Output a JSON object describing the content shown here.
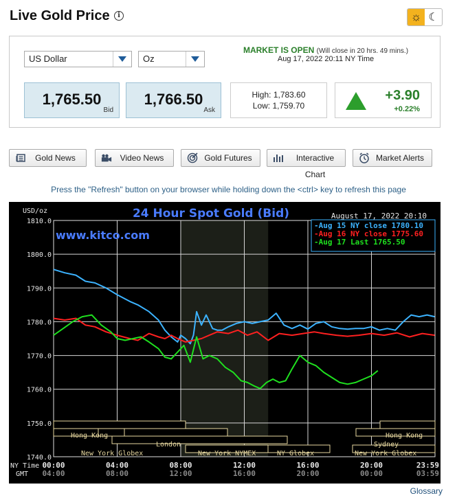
{
  "header": {
    "title": "Live Gold Price",
    "info_icon": "info-icon",
    "sun_icon": "sun-icon",
    "moon_icon": "moon-icon",
    "accent": "#f3b21e"
  },
  "selectors": {
    "currency": "US Dollar",
    "unit": "Oz"
  },
  "market": {
    "status": "MARKET IS OPEN",
    "note": "(Will close in 20 hrs. 49 mins.)",
    "time": "Aug 17, 2022 20:11 NY Time"
  },
  "quote": {
    "bid": "1,765.50",
    "bid_label": "Bid",
    "ask": "1,766.50",
    "ask_label": "Ask"
  },
  "range": {
    "high_label": "High:",
    "high": "1,783.60",
    "low_label": "Low:",
    "low": "1,759.70"
  },
  "change": {
    "amount": "+3.90",
    "percent": "+0.22%",
    "color": "#2a7f2a"
  },
  "buttons": [
    {
      "label": "Gold News",
      "icon": "newspaper-icon"
    },
    {
      "label": "Video News",
      "icon": "video-camera-icon"
    },
    {
      "label": "Gold Futures",
      "icon": "target-icon"
    },
    {
      "label": "Interactive Chart",
      "icon": "bar-chart-icon"
    },
    {
      "label": "Market Alerts",
      "icon": "alarm-clock-icon"
    }
  ],
  "refresh_note": "Press the \"Refresh\" button on your browser while holding down the <ctrl> key to refresh this page",
  "glossary": "Glossary",
  "chart_data": {
    "type": "line",
    "title": "24 Hour Spot Gold (Bid)",
    "timestamp": "August 17, 2022 20:10",
    "watermark": "www.kitco.com",
    "ylabel": "USD/oz",
    "ylim": [
      1740,
      1810
    ],
    "yticks": [
      "1810.0",
      "1800.0",
      "1790.0",
      "1780.0",
      "1770.0",
      "1760.0",
      "1750.0",
      "1740.0"
    ],
    "x_row1_label": "NY Time",
    "x_row2_label": "GMT",
    "xticks_ny": [
      "00:00",
      "04:00",
      "08:00",
      "12:00",
      "16:00",
      "20:00",
      "23:59"
    ],
    "xticks_gmt": [
      "04:00",
      "08:00",
      "12:00",
      "16:00",
      "20:00",
      "00:00",
      "03:59"
    ],
    "legend": [
      {
        "label": "Aug 15 NY close 1780.10",
        "color": "#3cb3ff"
      },
      {
        "label": "Aug 16 NY close 1775.60",
        "color": "#ff2020"
      },
      {
        "label": "Aug 17 Last 1765.50",
        "color": "#1fe01f"
      }
    ],
    "sessions": [
      "Hong Kong",
      "London",
      "New York Globex",
      "New York NYMEX",
      "NY Globex",
      "Sydney",
      "Hong Kong",
      "New York Globex"
    ],
    "series": [
      {
        "name": "Aug 15",
        "color": "#3cb3ff",
        "x": [
          0,
          0.7,
          1.4,
          2,
          2.6,
          3.3,
          4,
          4.8,
          5.3,
          6,
          6.6,
          7,
          7.4,
          7.8,
          8,
          8.3,
          8.6,
          8.8,
          9,
          9.3,
          9.6,
          10,
          10.3,
          10.6,
          11,
          11.5,
          12,
          12.5,
          13,
          13.5,
          14,
          14.5,
          15,
          15.5,
          16,
          16.5,
          17,
          17.5,
          18,
          18.5,
          19,
          19.5,
          20,
          20.5,
          21,
          21.5,
          22,
          22.5,
          23,
          23.5,
          23.98
        ],
        "values": [
          1795.5,
          1794.5,
          1793.8,
          1792,
          1791.5,
          1790,
          1788,
          1786,
          1785,
          1783,
          1780.5,
          1777.5,
          1775.5,
          1774,
          1776,
          1775,
          1773.5,
          1776,
          1783,
          1779,
          1782,
          1778,
          1777.5,
          1777.5,
          1778.5,
          1779.5,
          1780,
          1779.5,
          1780,
          1780.5,
          1782.5,
          1779,
          1778,
          1779,
          1777.8,
          1779.5,
          1780,
          1778.5,
          1778,
          1777.8,
          1778,
          1778,
          1778.5,
          1777.5,
          1778,
          1777.5,
          1780,
          1782,
          1781.5,
          1782,
          1781.5
        ]
      },
      {
        "name": "Aug 16",
        "color": "#ff2020",
        "x": [
          0,
          0.7,
          1.4,
          2,
          2.6,
          3.3,
          4,
          4.8,
          5.3,
          6,
          6.6,
          7,
          7.4,
          7.8,
          8.3,
          8.8,
          9.3,
          9.8,
          10.3,
          11,
          11.6,
          12.2,
          12.8,
          13.5,
          14.2,
          15,
          15.7,
          16.4,
          17,
          17.8,
          18.5,
          19.2,
          20,
          20.8,
          21.6,
          22.4,
          23.2,
          23.98
        ],
        "values": [
          1781,
          1780.5,
          1781,
          1779,
          1778.5,
          1777,
          1776,
          1775,
          1774.5,
          1776.5,
          1775.5,
          1775,
          1776,
          1775,
          1774,
          1774.5,
          1775,
          1776,
          1777,
          1776.5,
          1777.5,
          1776,
          1777,
          1774.5,
          1776.5,
          1776,
          1776.5,
          1777,
          1776.5,
          1776,
          1775.7,
          1776,
          1776.5,
          1776,
          1776.7,
          1775.5,
          1776.5,
          1776
        ]
      },
      {
        "name": "Aug 17",
        "color": "#1fe01f",
        "x": [
          0,
          0.6,
          1.2,
          1.8,
          2.4,
          3,
          3.6,
          4,
          4.5,
          5,
          5.5,
          6,
          6.6,
          7,
          7.4,
          7.8,
          8.2,
          8.6,
          9,
          9.4,
          9.8,
          10.3,
          10.8,
          11.3,
          11.8,
          12.2,
          12.6,
          13,
          13.4,
          13.8,
          14.2,
          14.6,
          15,
          15.5,
          16,
          16.5,
          17,
          17.5,
          18,
          18.5,
          19,
          19.5,
          20,
          20.4
        ],
        "values": [
          1776,
          1778,
          1780,
          1781.5,
          1782,
          1779,
          1777,
          1775,
          1774.5,
          1775,
          1775.5,
          1774,
          1772,
          1769.5,
          1769,
          1771,
          1773,
          1768,
          1775.5,
          1769,
          1770,
          1769,
          1766.5,
          1765,
          1762.5,
          1762,
          1761,
          1760.2,
          1762,
          1763,
          1762,
          1762.5,
          1766,
          1770,
          1768,
          1767,
          1765,
          1763.5,
          1762,
          1761.5,
          1762,
          1763,
          1764,
          1765.5
        ]
      }
    ]
  }
}
